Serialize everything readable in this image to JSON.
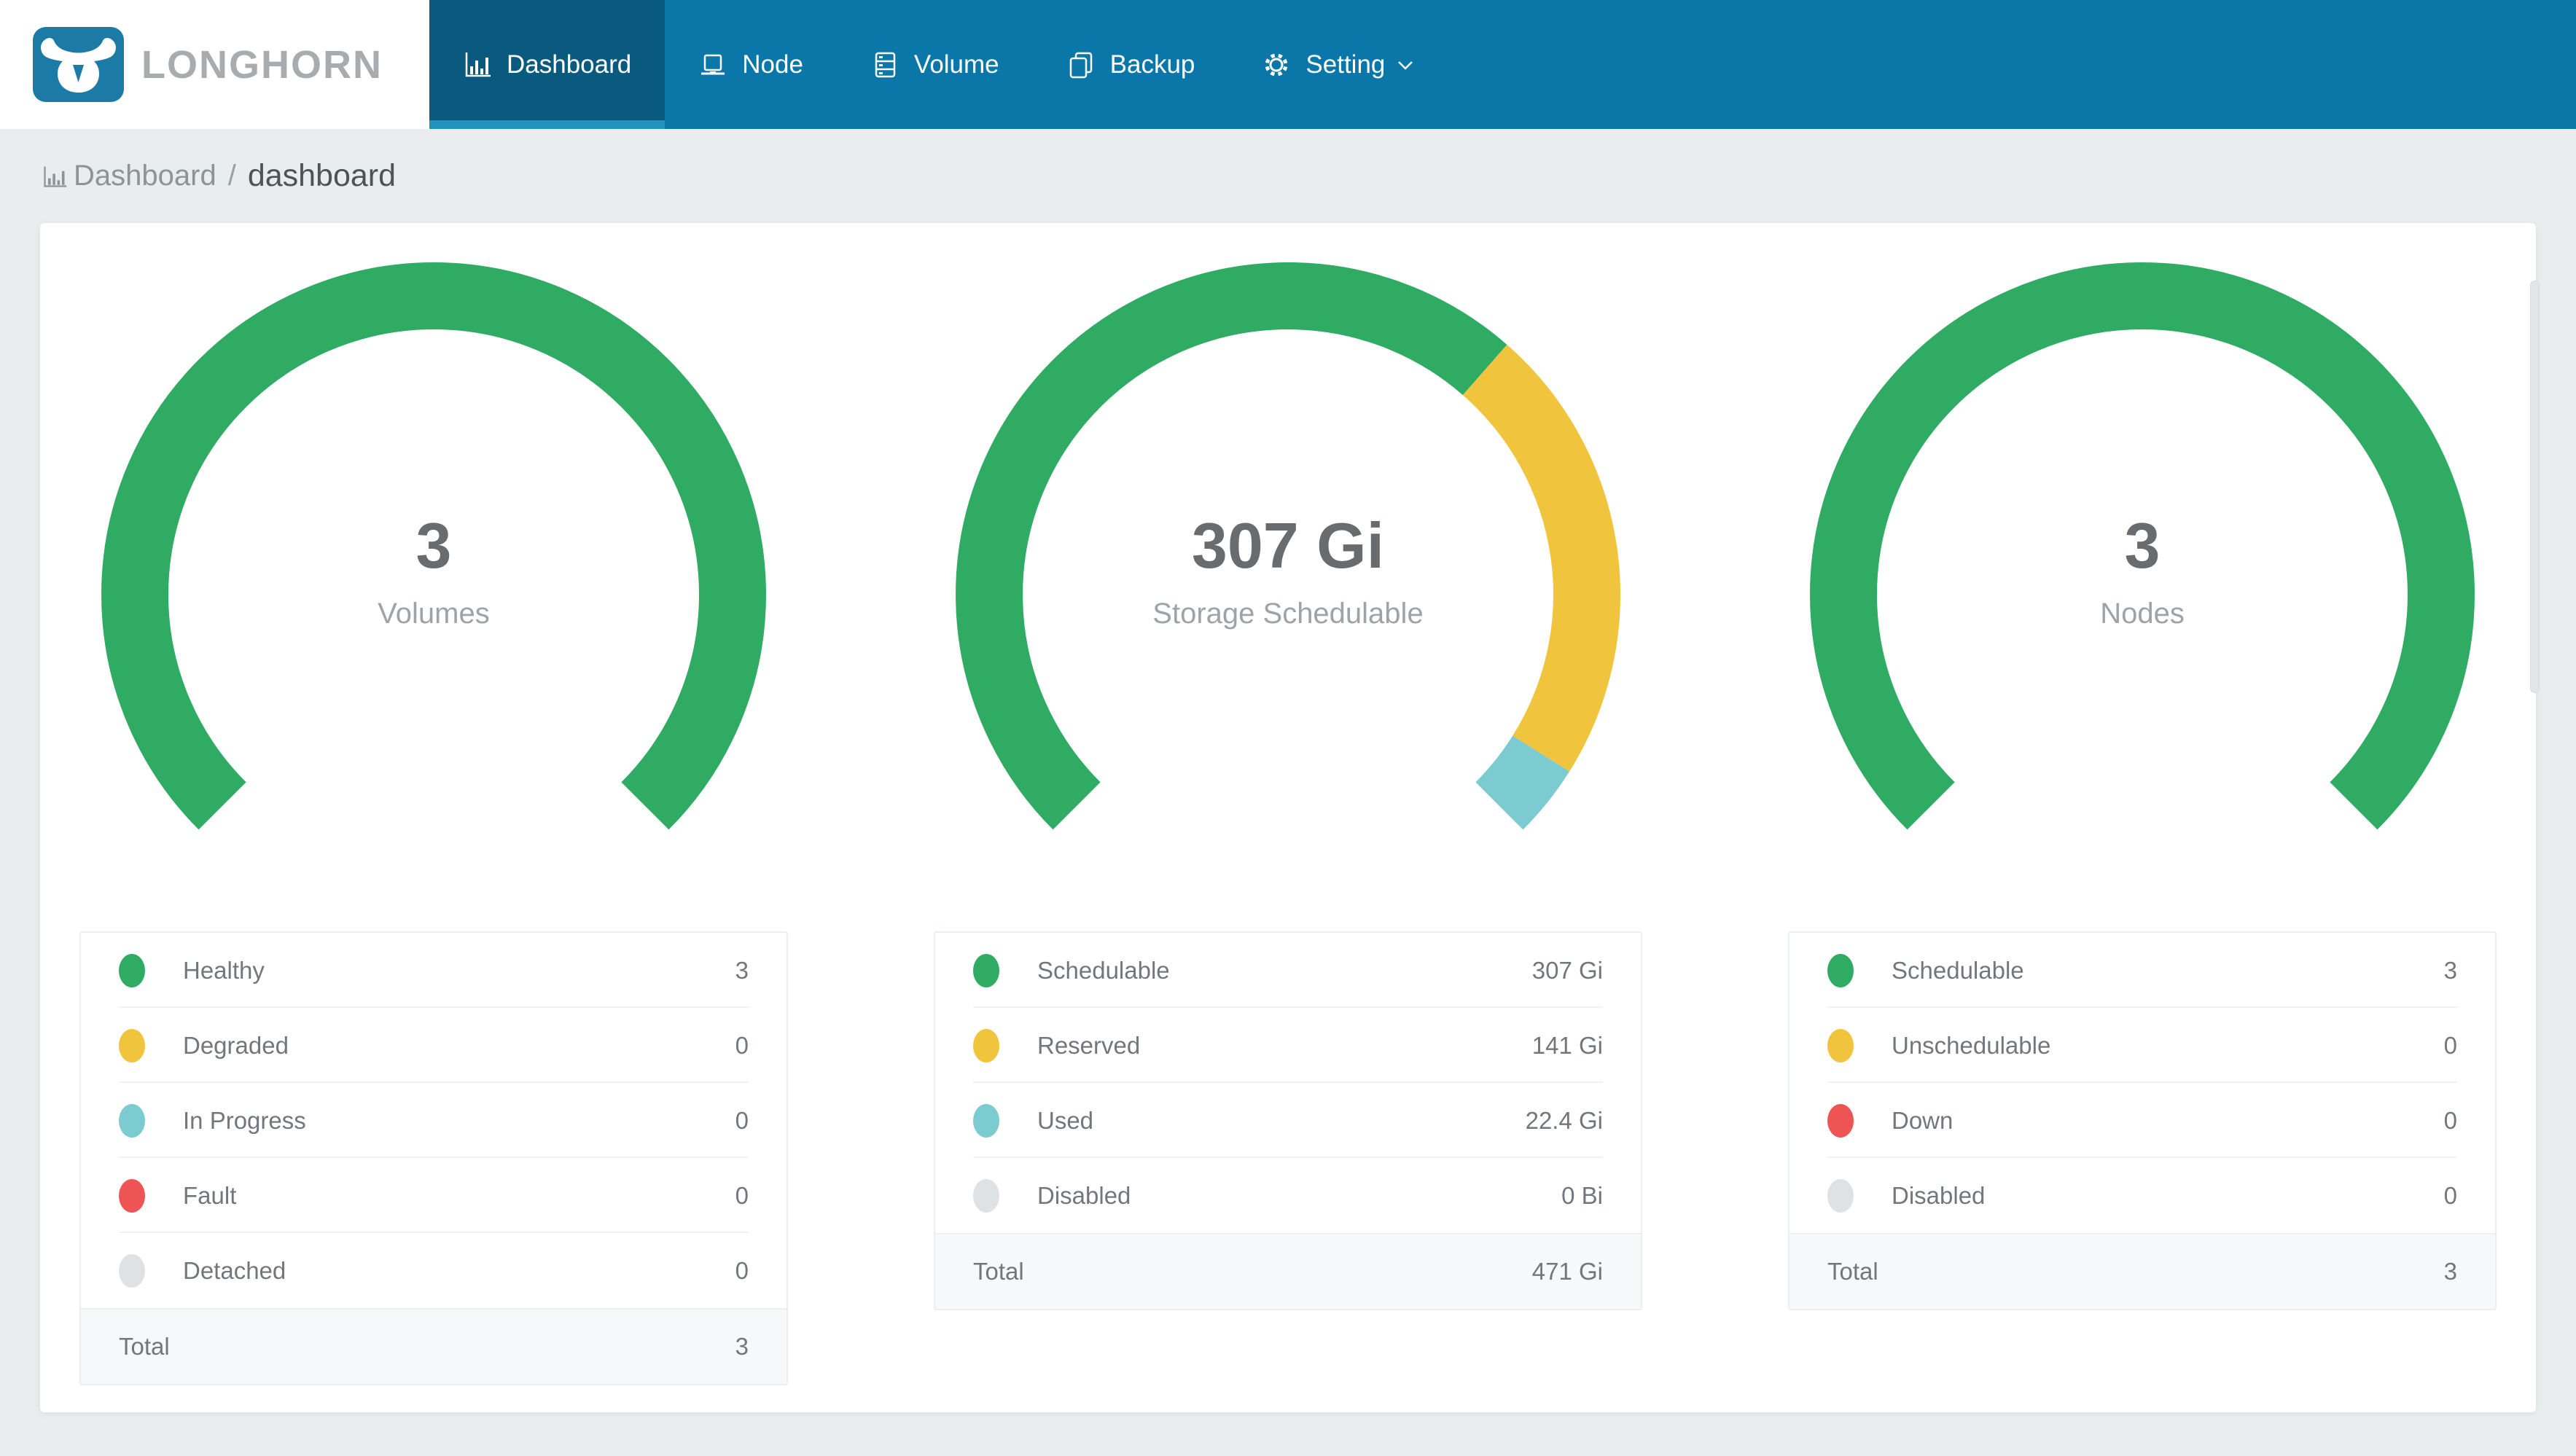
{
  "nav": {
    "brand": "LONGHORN",
    "items": [
      {
        "label": "Dashboard",
        "icon": "bar-chart-icon",
        "active": true
      },
      {
        "label": "Node",
        "icon": "laptop-icon",
        "active": false
      },
      {
        "label": "Volume",
        "icon": "server-icon",
        "active": false
      },
      {
        "label": "Backup",
        "icon": "copy-icon",
        "active": false
      },
      {
        "label": "Setting",
        "icon": "gear-icon",
        "active": false,
        "has_dropdown": true
      }
    ]
  },
  "breadcrumb": {
    "root": "Dashboard",
    "separator": "/",
    "current": "dashboard"
  },
  "colors": {
    "navbar": "#0B76A8",
    "navbar_active": "#0A5A80",
    "navbar_active_underline": "#2191BD",
    "brand_text": "#A9ACAF",
    "page_background": "#E9EDEE",
    "healthy_green": "#2FAB63",
    "warning_yellow": "#F0C53D",
    "progress_teal": "#7BCBD1",
    "fault_red": "#EF5455",
    "disabled_gray": "#DFE2E4"
  },
  "chart_data": [
    {
      "type": "pie",
      "variant": "donut-gauge",
      "start_bearing_deg": 225,
      "sweep_deg": 270,
      "legend_position": "bottom",
      "center": {
        "value": "3",
        "label": "Volumes"
      },
      "items": [
        {
          "label": "Healthy",
          "value": 3,
          "display": "3",
          "color": "#2FAB63"
        },
        {
          "label": "Degraded",
          "value": 0,
          "display": "0",
          "color": "#F0C53D"
        },
        {
          "label": "In Progress",
          "value": 0,
          "display": "0",
          "color": "#7BCBD1"
        },
        {
          "label": "Fault",
          "value": 0,
          "display": "0",
          "color": "#EF5455"
        },
        {
          "label": "Detached",
          "value": 0,
          "display": "0",
          "color": "#DFE2E4"
        }
      ],
      "total": {
        "label": "Total",
        "value": 3,
        "display": "3"
      }
    },
    {
      "type": "pie",
      "variant": "donut-gauge",
      "start_bearing_deg": 225,
      "sweep_deg": 270,
      "legend_position": "bottom",
      "center": {
        "value": "307 Gi",
        "label": "Storage Schedulable"
      },
      "items": [
        {
          "label": "Schedulable",
          "value": 307,
          "display": "307 Gi",
          "color": "#2FAB63"
        },
        {
          "label": "Reserved",
          "value": 141,
          "display": "141 Gi",
          "color": "#F0C53D"
        },
        {
          "label": "Used",
          "value": 22.4,
          "display": "22.4 Gi",
          "color": "#7BCBD1"
        },
        {
          "label": "Disabled",
          "value": 0,
          "display": "0 Bi",
          "color": "#DFE2E4"
        }
      ],
      "total": {
        "label": "Total",
        "value": 470.4,
        "display": "471 Gi"
      }
    },
    {
      "type": "pie",
      "variant": "donut-gauge",
      "start_bearing_deg": 225,
      "sweep_deg": 270,
      "legend_position": "bottom",
      "center": {
        "value": "3",
        "label": "Nodes"
      },
      "items": [
        {
          "label": "Schedulable",
          "value": 3,
          "display": "3",
          "color": "#2FAB63"
        },
        {
          "label": "Unschedulable",
          "value": 0,
          "display": "0",
          "color": "#F0C53D"
        },
        {
          "label": "Down",
          "value": 0,
          "display": "0",
          "color": "#EF5455"
        },
        {
          "label": "Disabled",
          "value": 0,
          "display": "0",
          "color": "#DFE2E4"
        }
      ],
      "total": {
        "label": "Total",
        "value": 3,
        "display": "3"
      }
    }
  ]
}
